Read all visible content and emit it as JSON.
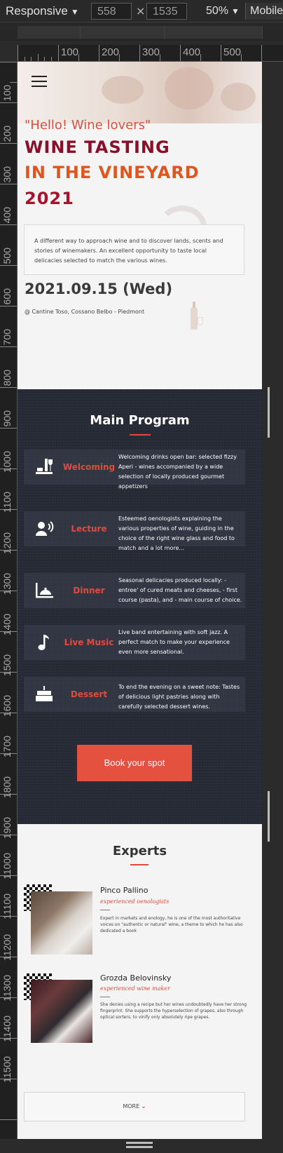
{
  "devtools": {
    "device": "Responsive",
    "width": "558",
    "height": "1535",
    "times": "×",
    "zoom": "50%",
    "mode": "Mobile",
    "ruler_h": [
      "100",
      "200",
      "300",
      "400",
      "500"
    ],
    "ruler_v": [
      "100",
      "200",
      "300",
      "400",
      "500",
      "600",
      "700",
      "800",
      "900",
      "1000",
      "1100",
      "1200",
      "1300",
      "1400",
      "1500",
      "1600",
      "1700",
      "1800",
      "1900",
      "11000",
      "11100",
      "11200",
      "11300",
      "11400",
      "11500"
    ]
  },
  "hero": {
    "hello": "\"Hello! Wine lovers\"",
    "title_line1": "WINE TASTING",
    "title_line2": "IN THE VINEYARD",
    "title_line3": "2021",
    "intro": "A different way to approach wine and to discover lands, scents and stories of winemakers. An excellent opportunity to taste local delicacies selected to match the various wines.",
    "date": "2021.09.15 (Wed)",
    "venue": "@ Cantine Toso, Cossano Belbo - Piedmont"
  },
  "program": {
    "title": "Main Program",
    "items": [
      {
        "icon": "wine-bottle-glass-icon",
        "label": "Welcoming",
        "desc": "Welcoming drinks open bar: selected fizzy Aperi - wines accompanied by a wide selection of locally produced gourmet appetizers"
      },
      {
        "icon": "speaker-icon",
        "label": "Lecture",
        "desc": "Esteemed oenologists explaining the various properties of wine, guiding in the choice of the right wine glass and food to match and a lot more..."
      },
      {
        "icon": "dinner-plate-icon",
        "label": "Dinner",
        "desc": "Seasonal delicacies produced locally: - entree' of cured meats and cheeses, - first course (pasta), and - main course of choice."
      },
      {
        "icon": "music-note-icon",
        "label": "Live Music",
        "desc": "Live band entertaining with soft jazz. A perfect match to make your experience even more sensational."
      },
      {
        "icon": "cake-icon",
        "label": "Dessert",
        "desc": "To end the evening on a sweet note: Tastes of delicious light pastries along with carefully selected dessert wines."
      }
    ],
    "book_label": "Book your spot"
  },
  "experts": {
    "title": "Experts",
    "people": [
      {
        "name": "Pinco Pallino",
        "role": "experienced oenologists",
        "bio": "Expert in markets and enology, he is one of the most authoritative voices on \"authentic or natural\" wine, a theme to which he has also dedicated a book"
      },
      {
        "name": "Grozda Belovinsky",
        "role": "experienced wine maker",
        "bio": "She denies using a recipe but her wines undoubtedly have her strong fingerprint. She supports the hyperselection of grapes, also through optical sorters, to vinify only absolutely ripe grapes."
      }
    ],
    "more_label": "MORE",
    "more_icon": "chevron-down-icon"
  },
  "colors": {
    "accent": "#e04b3c",
    "dark_bg": "#262a35",
    "title_red": "#8a0f2a",
    "title_orange": "#e0541e"
  }
}
